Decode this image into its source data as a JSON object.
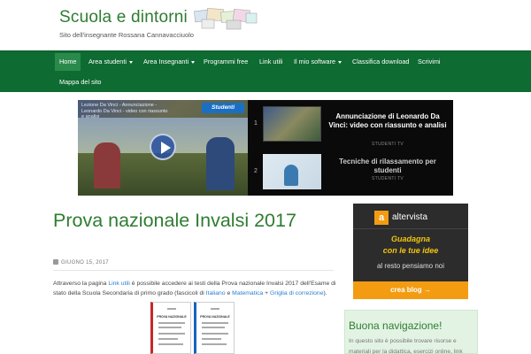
{
  "header": {
    "title": "Scuola e dintorni",
    "tagline": "Sito dell'insegnante Rossana Cannavacciuolo"
  },
  "nav": {
    "items": [
      {
        "label": "Home",
        "active": true
      },
      {
        "label": "Area studenti",
        "dropdown": true
      },
      {
        "label": "Area Insegnanti",
        "dropdown": true
      },
      {
        "label": "Programmi free"
      },
      {
        "label": "Link utili"
      },
      {
        "label": "Il mio software",
        "dropdown": true
      },
      {
        "label": "Classifica download"
      },
      {
        "label": "Scrivimi"
      },
      {
        "label": "Mappa del sito"
      }
    ]
  },
  "video": {
    "main_overlay": "Lezione Da Vinci - Annunciazione - Leonardo Da Vinci - video con riassunto e analisi",
    "badge": "Studenti",
    "playlist": [
      {
        "num": "1",
        "title": "Annunciazione di Leonardo Da Vinci: video con riassunto e analisi",
        "channel": "STUDENTI TV"
      },
      {
        "num": "2",
        "title": "Tecniche di rilassamento per studenti",
        "channel": "STUDENTI TV"
      }
    ]
  },
  "post": {
    "title": "Prova nazionale Invalsi 2017",
    "date": "GIUGNO 15, 2017",
    "body_pre": "Attraverso la pagina ",
    "link1": "Link utili",
    "body_mid": " è possibile accedere ai testi della Prova nazionale Invalsi 2017 dell'Esame di stato della Scuola Secondaria di primo grado (fascicoli di ",
    "link2": "Italiano",
    "body_and": " e ",
    "link3": "Matematica",
    "body_plus": " + ",
    "link4": "Griglia di correzione",
    "body_end": ").",
    "doc1_head": "PROVA NAZIONALE",
    "doc2_head": "PROVA NAZIONALE"
  },
  "ad": {
    "logo": "a",
    "brand": "altervista",
    "slogan1": "Guadagna",
    "slogan2": "con le tue idee",
    "text": "al resto pensiamo noi",
    "button": "crea blog →"
  },
  "widget": {
    "title": "Buona navigazione!",
    "body": "In questo sito è possibile trovare risorse e materiali per la didattica, esercizi online, link"
  },
  "colors": {
    "brand_green": "#2e7d32",
    "nav_bg": "#0e6b31",
    "link_blue": "#2a7fd0",
    "ad_orange": "#f39c12"
  }
}
